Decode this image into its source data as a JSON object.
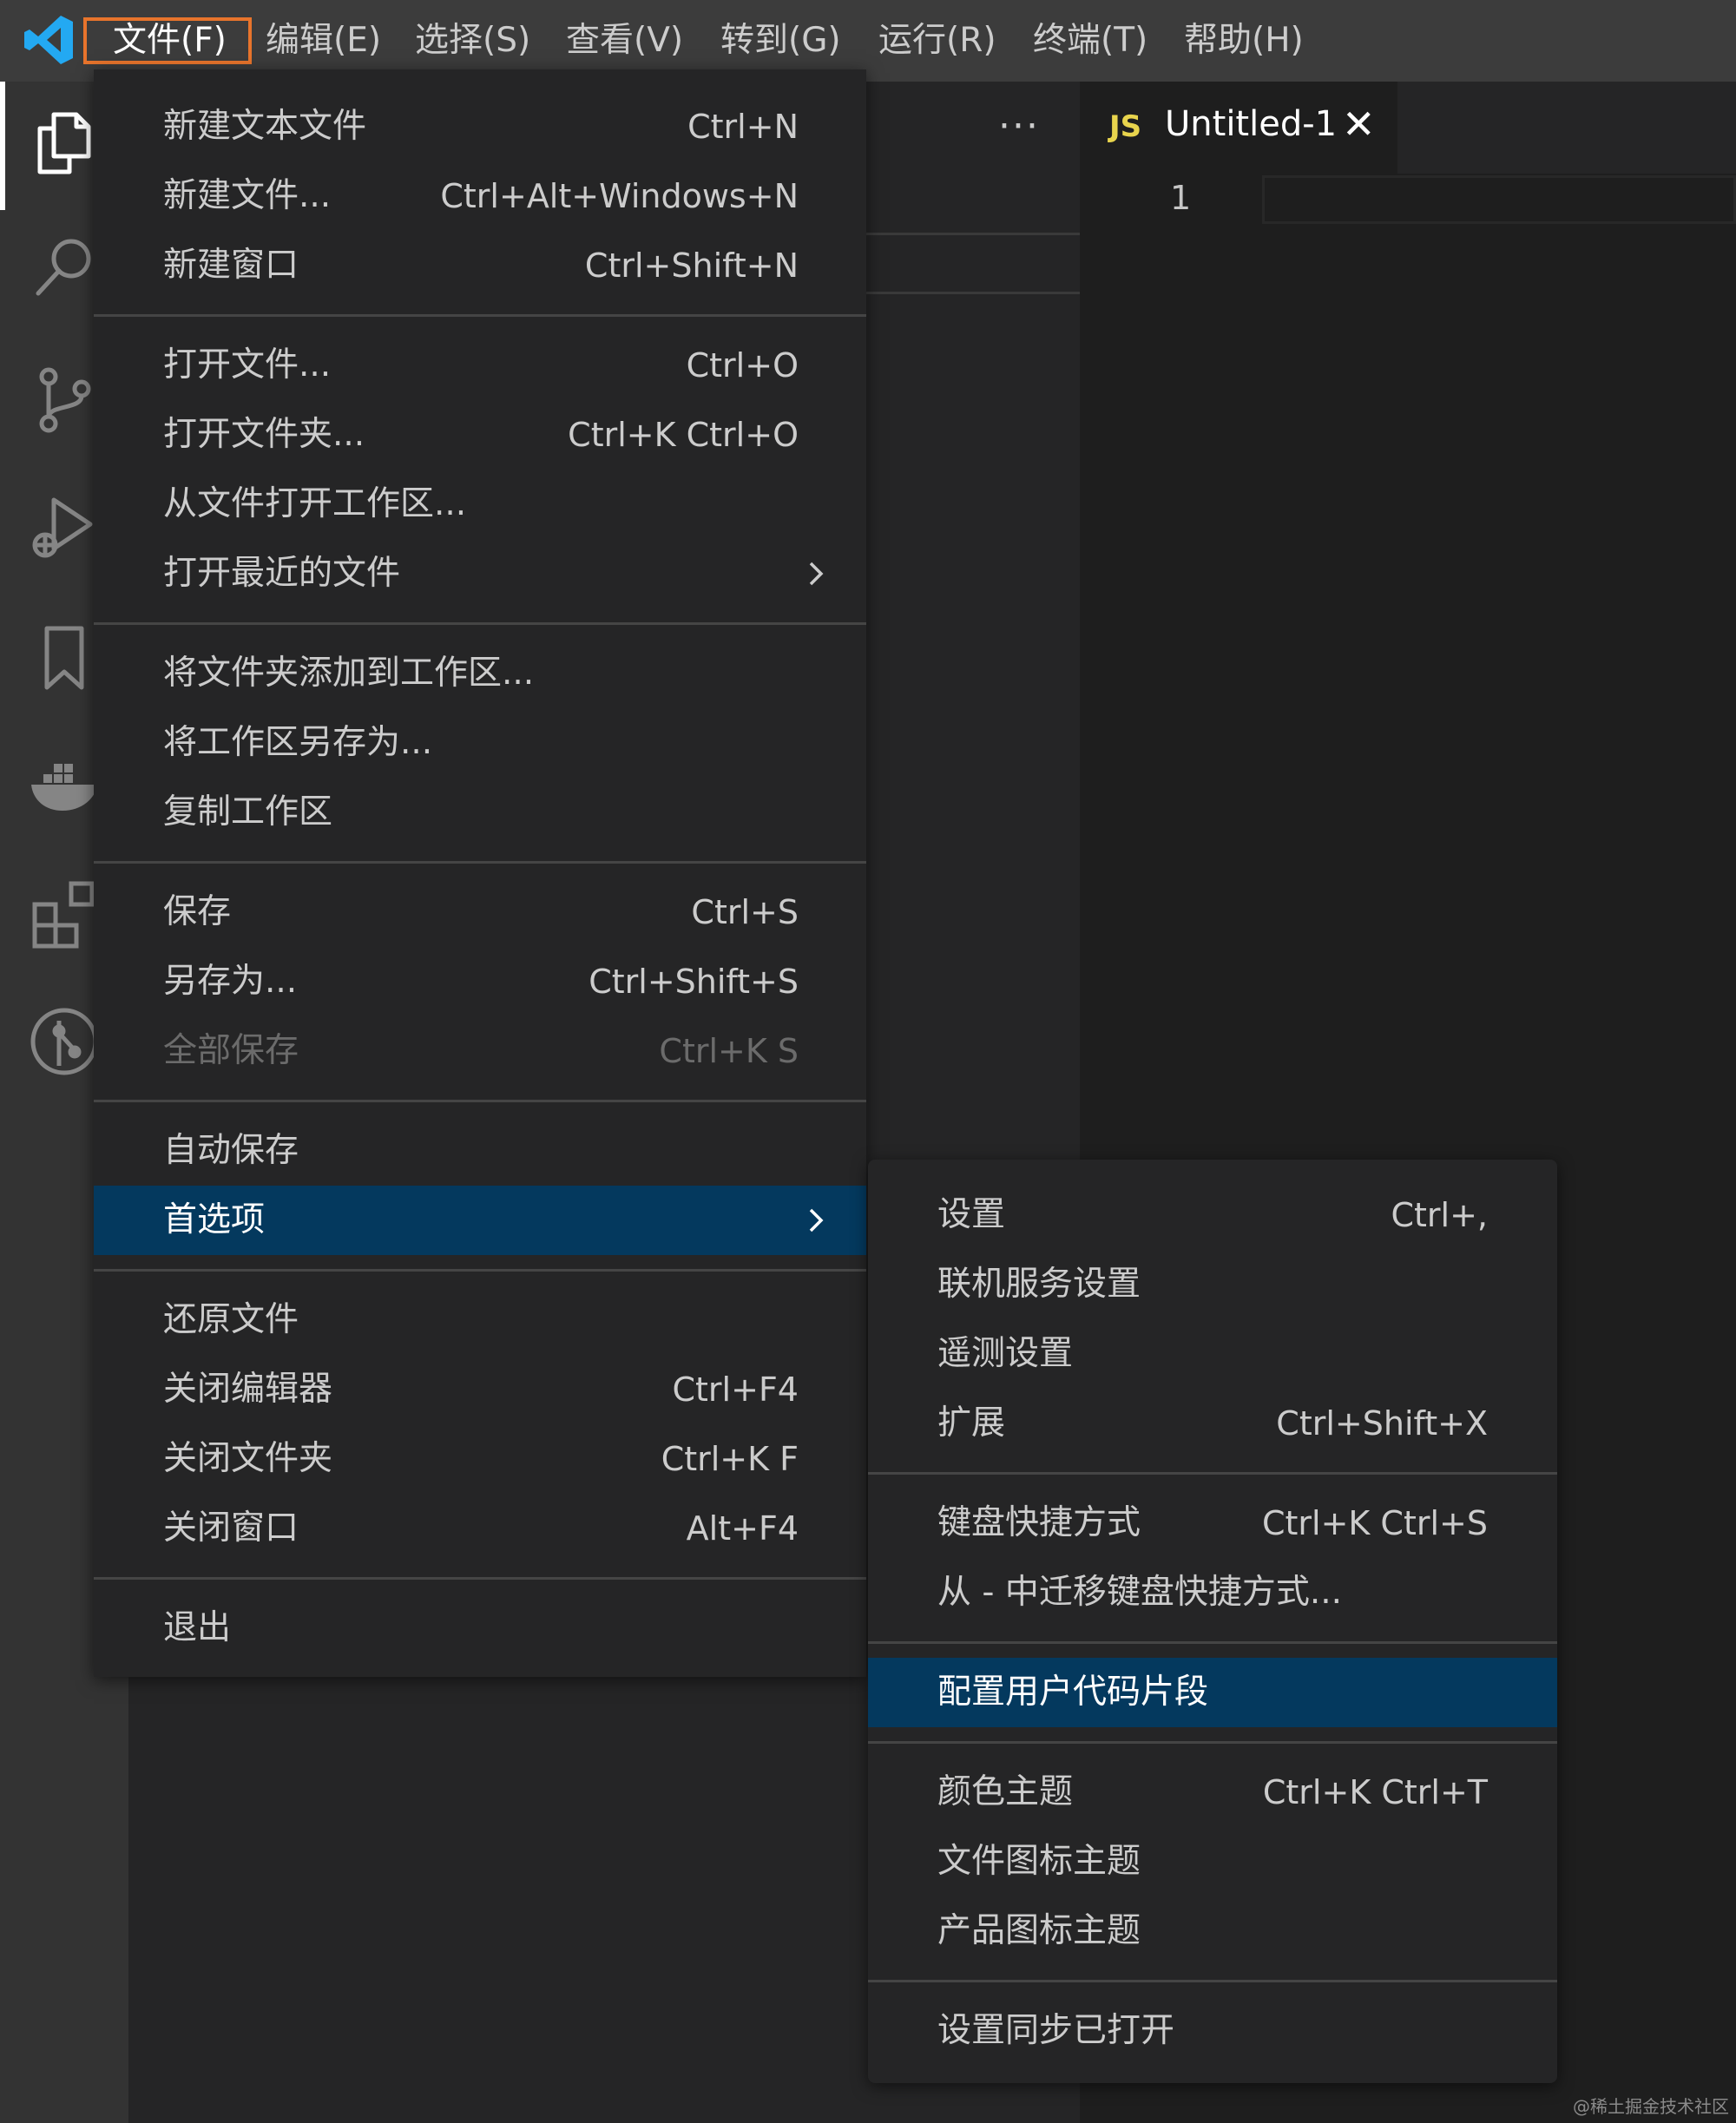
{
  "menubar": {
    "items": [
      "文件(F)",
      "编辑(E)",
      "选择(S)",
      "查看(V)",
      "转到(G)",
      "运行(R)",
      "终端(T)",
      "帮助(H)"
    ],
    "open_item": "文件(F)"
  },
  "activity_bar": {
    "icons": [
      "files-icon",
      "search-icon",
      "source-control-icon",
      "run-debug-icon",
      "bookmark-icon",
      "docker-icon",
      "extensions-icon",
      "git-graph-icon"
    ]
  },
  "sidebar": {
    "more_actions": "···"
  },
  "editor": {
    "tab": {
      "language_badge": "JS",
      "title": "Untitled-1",
      "close": "✕"
    },
    "line_number": "1"
  },
  "file_menu": {
    "groups": [
      [
        {
          "label": "新建文本文件",
          "key": "Ctrl+N"
        },
        {
          "label": "新建文件...",
          "key": "Ctrl+Alt+Windows+N"
        },
        {
          "label": "新建窗口",
          "key": "Ctrl+Shift+N"
        }
      ],
      [
        {
          "label": "打开文件...",
          "key": "Ctrl+O"
        },
        {
          "label": "打开文件夹...",
          "key": "Ctrl+K Ctrl+O"
        },
        {
          "label": "从文件打开工作区...",
          "key": ""
        },
        {
          "label": "打开最近的文件",
          "key": "",
          "submenu": true
        }
      ],
      [
        {
          "label": "将文件夹添加到工作区...",
          "key": ""
        },
        {
          "label": "将工作区另存为...",
          "key": ""
        },
        {
          "label": "复制工作区",
          "key": ""
        }
      ],
      [
        {
          "label": "保存",
          "key": "Ctrl+S"
        },
        {
          "label": "另存为...",
          "key": "Ctrl+Shift+S"
        },
        {
          "label": "全部保存",
          "key": "Ctrl+K S",
          "disabled": true
        }
      ],
      [
        {
          "label": "自动保存",
          "key": ""
        },
        {
          "label": "首选项",
          "key": "",
          "submenu": true,
          "highlighted": true
        }
      ],
      [
        {
          "label": "还原文件",
          "key": ""
        },
        {
          "label": "关闭编辑器",
          "key": "Ctrl+F4"
        },
        {
          "label": "关闭文件夹",
          "key": "Ctrl+K F"
        },
        {
          "label": "关闭窗口",
          "key": "Alt+F4"
        }
      ],
      [
        {
          "label": "退出",
          "key": ""
        }
      ]
    ]
  },
  "preferences_menu": {
    "groups": [
      [
        {
          "label": "设置",
          "key": "Ctrl+,"
        },
        {
          "label": "联机服务设置",
          "key": ""
        },
        {
          "label": "遥测设置",
          "key": ""
        },
        {
          "label": "扩展",
          "key": "Ctrl+Shift+X"
        }
      ],
      [
        {
          "label": "键盘快捷方式",
          "key": "Ctrl+K Ctrl+S"
        },
        {
          "label": "从 - 中迁移键盘快捷方式...",
          "key": ""
        }
      ],
      [
        {
          "label": "配置用户代码片段",
          "key": "",
          "highlighted": true
        }
      ],
      [
        {
          "label": "颜色主题",
          "key": "Ctrl+K Ctrl+T"
        },
        {
          "label": "文件图标主题",
          "key": ""
        },
        {
          "label": "产品图标主题",
          "key": ""
        }
      ],
      [
        {
          "label": "设置同步已打开",
          "key": ""
        }
      ]
    ]
  },
  "watermark": "@稀土掘金技术社区",
  "colors": {
    "menu_highlight": "#04395e",
    "open_menu_outline": "#e8742c",
    "js_badge": "#e8d44d",
    "vscode_blue": "#23a9f2"
  }
}
